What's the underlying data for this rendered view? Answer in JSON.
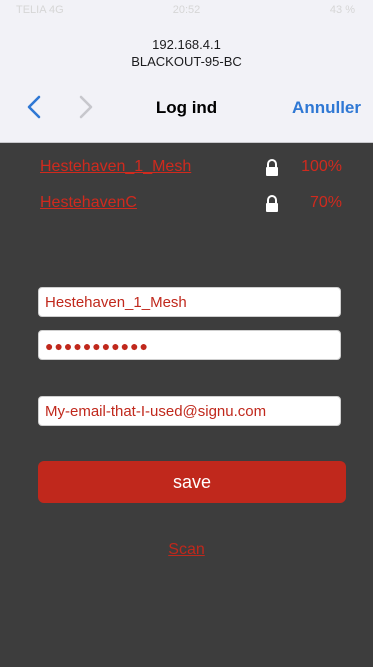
{
  "status_bar": {
    "carrier": "TELIA 4G",
    "time": "20:52",
    "battery": "43 %"
  },
  "browser": {
    "host": "192.168.4.1",
    "device": "BLACKOUT-95-BC",
    "title": "Log ind",
    "cancel_label": "Annuller"
  },
  "networks": [
    {
      "name": "Hestehaven_1_Mesh",
      "signal": "100%",
      "icon": "lock-icon"
    },
    {
      "name": "HestehavenC",
      "signal": "70%",
      "icon": "lock-icon"
    }
  ],
  "form": {
    "ssid": "Hestehaven_1_Mesh",
    "password_mask": "●●●●●●●●●●●",
    "email": "My-email-that-I-used@signu.com",
    "save_label": "save",
    "scan_label": "Scan"
  },
  "colors": {
    "accent": "#c0281c",
    "link": "#d02a1e",
    "background": "#3d3d3d",
    "ios_blue": "#2f78d4"
  }
}
